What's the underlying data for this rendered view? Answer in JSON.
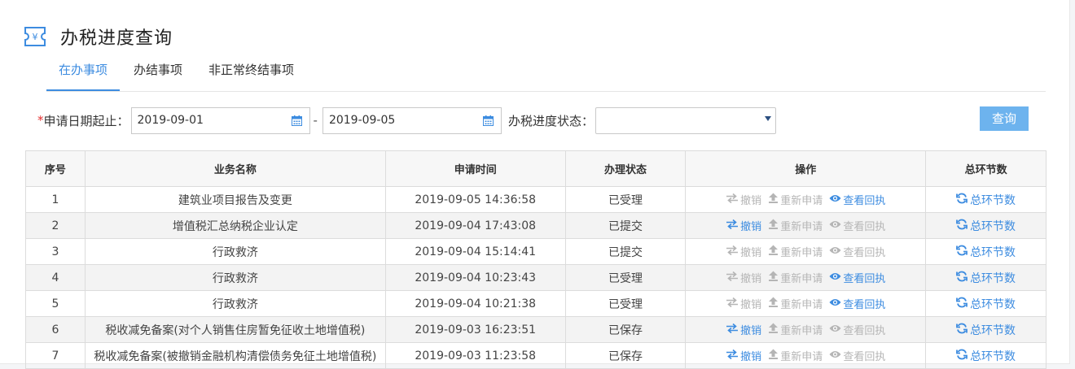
{
  "header": {
    "title": "办税进度查询"
  },
  "tabs": [
    {
      "label": "在办事项"
    },
    {
      "label": "办结事项"
    },
    {
      "label": "非正常终结事项"
    }
  ],
  "filters": {
    "required_mark": "*",
    "date_label": "申请日期起止：",
    "date_start": "2019-09-01",
    "date_sep": "-",
    "date_end": "2019-09-05",
    "status_label": "办税进度状态：",
    "status_value": "",
    "query_button": "查询"
  },
  "table": {
    "columns": [
      "序号",
      "业务名称",
      "申请时间",
      "办理状态",
      "操作",
      "总环节数"
    ],
    "ops_labels": {
      "revoke": "撤销",
      "reapply": "重新申请",
      "receipt": "查看回执"
    },
    "total_label": "总环节数",
    "rows": [
      {
        "no": "1",
        "name": "建筑业项目报告及变更",
        "time": "2019-09-05 14:36:58",
        "status": "已受理",
        "revoke": false,
        "reapply": false,
        "receipt": true
      },
      {
        "no": "2",
        "name": "增值税汇总纳税企业认定",
        "time": "2019-09-04 17:43:08",
        "status": "已提交",
        "revoke": true,
        "reapply": false,
        "receipt": false
      },
      {
        "no": "3",
        "name": "行政救济",
        "time": "2019-09-04 15:14:41",
        "status": "已提交",
        "revoke": false,
        "reapply": false,
        "receipt": false
      },
      {
        "no": "4",
        "name": "行政救济",
        "time": "2019-09-04 10:23:43",
        "status": "已受理",
        "revoke": false,
        "reapply": false,
        "receipt": true
      },
      {
        "no": "5",
        "name": "行政救济",
        "time": "2019-09-04 10:21:38",
        "status": "已受理",
        "revoke": false,
        "reapply": false,
        "receipt": true
      },
      {
        "no": "6",
        "name": "税收减免备案(对个人销售住房暂免征收土地增值税)",
        "time": "2019-09-03 16:23:51",
        "status": "已保存",
        "revoke": true,
        "reapply": false,
        "receipt": false
      },
      {
        "no": "7",
        "name": "税收减免备案(被撤销金融机构清偿债务免征土地增值税)",
        "time": "2019-09-03 11:23:58",
        "status": "已保存",
        "revoke": true,
        "reapply": false,
        "receipt": false
      }
    ]
  },
  "colors": {
    "accent": "#3d8ce0",
    "disabled": "#b5b5b5",
    "button": "#6db3ee"
  },
  "icons": {
    "logo": "tax-receipt-icon",
    "calendar": "calendar-icon",
    "revoke": "swap-arrows-icon",
    "reapply": "upload-icon",
    "receipt": "eye-icon",
    "total": "refresh-icon"
  }
}
